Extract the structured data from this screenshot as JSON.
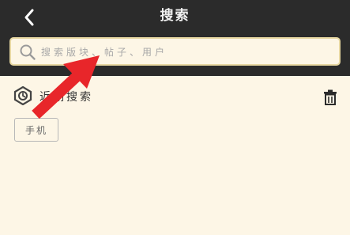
{
  "header": {
    "title": "搜索"
  },
  "search": {
    "placeholder": "搜索版块、帖子、用户",
    "value": ""
  },
  "history": {
    "label": "近期搜索",
    "items": [
      "手机"
    ]
  },
  "colors": {
    "header_bg": "#2b2b2b",
    "page_bg": "#fdf6e6",
    "annotation_arrow": "#e8262a"
  },
  "icons": {
    "back": "chevron-left-icon",
    "search": "search-icon",
    "history": "history-icon",
    "clear": "trash-icon"
  }
}
